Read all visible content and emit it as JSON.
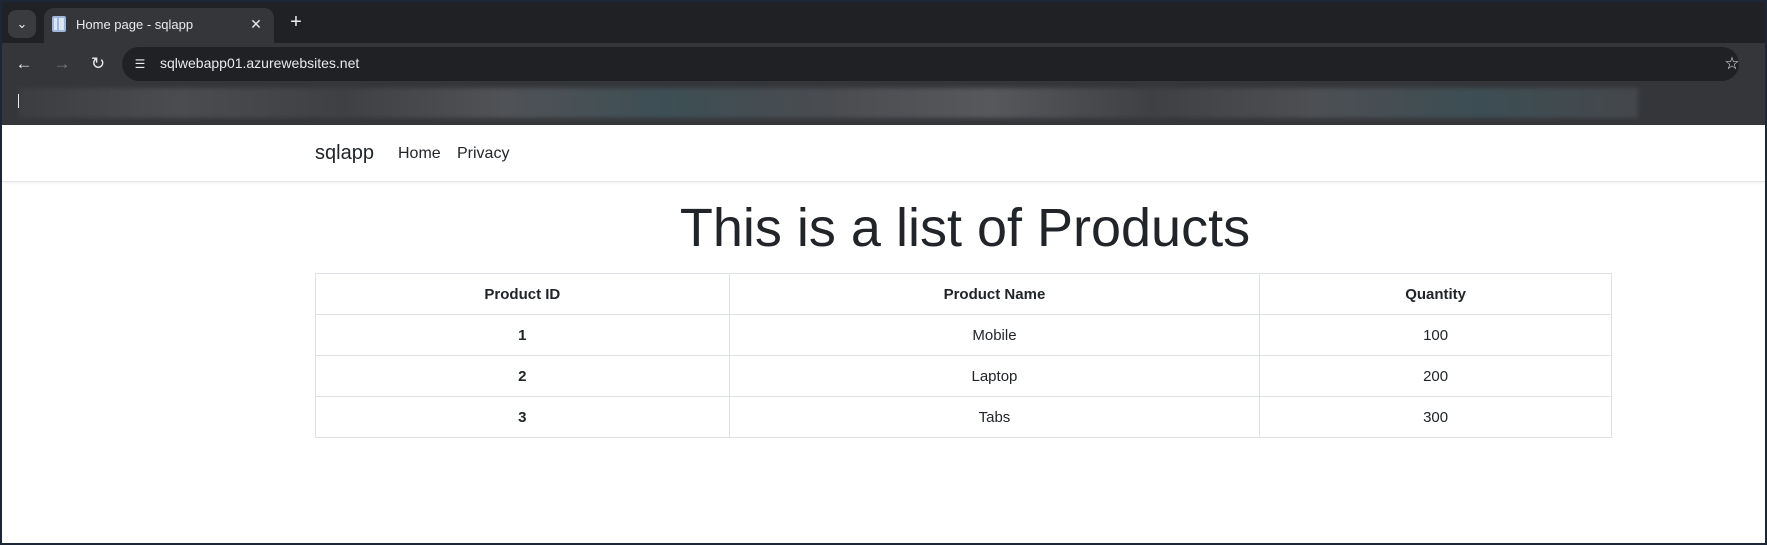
{
  "browser": {
    "tab": {
      "title": "Home page - sqlapp"
    },
    "address": {
      "url": "sqlwebapp01.azurewebsites.net"
    }
  },
  "site": {
    "brand": "sqlapp",
    "nav": [
      "Home",
      "Privacy"
    ]
  },
  "main": {
    "heading": "This is a list of Products",
    "table": {
      "headers": [
        "Product ID",
        "Product Name",
        "Quantity"
      ],
      "rows": [
        [
          "1",
          "Mobile",
          "100"
        ],
        [
          "2",
          "Laptop",
          "200"
        ],
        [
          "3",
          "Tabs",
          "300"
        ]
      ]
    }
  },
  "icons": {
    "tab_search": "chevron-down-icon",
    "favicon": "page-icon",
    "close": "close-icon",
    "new_tab": "plus-icon",
    "back": "arrow-left-icon",
    "forward": "arrow-right-icon",
    "reload": "reload-icon",
    "site_info": "tune-icon",
    "bookmark": "star-icon"
  },
  "colors": {
    "browser_frame": "#202124",
    "toolbar": "#35363a",
    "page_background": "#ffffff",
    "text": "#212529",
    "table_border": "#dee2e6"
  }
}
